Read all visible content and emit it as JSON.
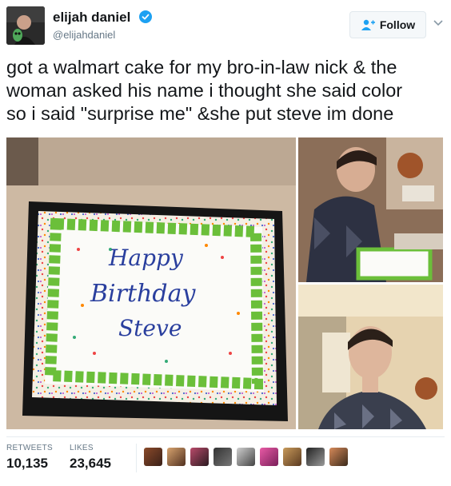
{
  "user": {
    "name": "elijah daniel",
    "handle": "@elijahdaniel",
    "verified": true,
    "follow_label": "Follow"
  },
  "tweet": {
    "text_lines": [
      "got a walmart cake for my bro-in-law nick & the",
      "woman asked his name i thought she said color",
      "so i said \"surprise me\" &she put steve im done"
    ]
  },
  "media": {
    "cake_text": [
      "Happy",
      "Birthday",
      "Steve"
    ]
  },
  "stats": {
    "retweets_label": "RETWEETS",
    "retweets_value": "10,135",
    "likes_label": "LIKES",
    "likes_value": "23,645"
  },
  "colors": {
    "accent": "#1da1f2",
    "text": "#14171a",
    "muted": "#657786",
    "frosting_green": "#6bbf3a",
    "icing_blue": "#2a3f9e"
  },
  "icons": {
    "verified": "verified-badge-icon",
    "follow": "add-person-icon",
    "menu": "chevron-down-icon"
  }
}
